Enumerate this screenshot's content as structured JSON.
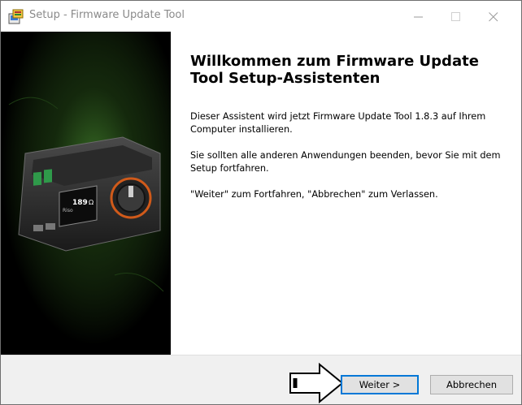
{
  "window": {
    "title": "Setup - Firmware Update Tool",
    "accent_color": "#0078d7",
    "controls": [
      "minimize-icon",
      "maximize-icon",
      "close-icon"
    ]
  },
  "sidebar": {
    "device_screen_text": "189",
    "device_screen_unit": "Ω",
    "device_screen_small": "Riso"
  },
  "content": {
    "heading": "Willkommen zum Firmware Update Tool Setup-Assistenten",
    "paragraph1": "Dieser Assistent wird jetzt Firmware Update Tool 1.8.3 auf Ihrem Computer installieren.",
    "paragraph2": "Sie sollten alle anderen Anwendungen beenden, bevor Sie mit dem Setup fortfahren.",
    "paragraph3": "\"Weiter\" zum Fortfahren, \"Abbrechen\" zum Verlassen."
  },
  "footer": {
    "next_label": "Weiter >",
    "cancel_label": "Abbrechen"
  }
}
